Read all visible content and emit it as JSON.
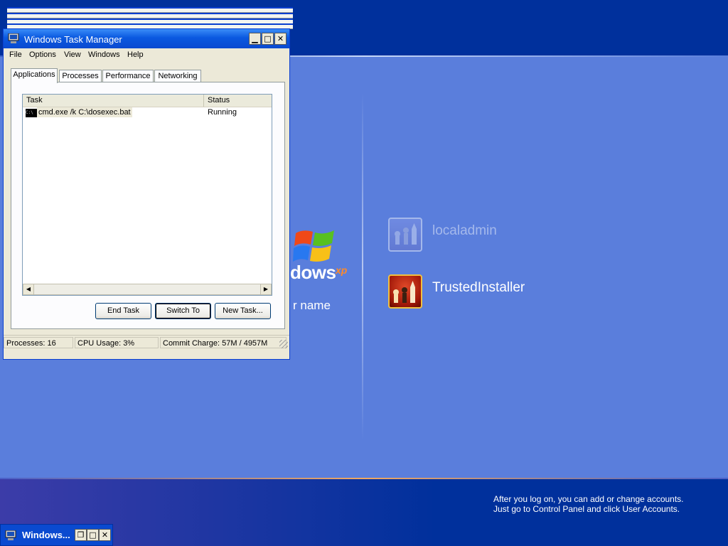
{
  "welcome": {
    "logo_text": "dows",
    "logo_xp": "xp",
    "logo_subtext": "r name",
    "help_line_1": "After you log on, you can add or change accounts.",
    "help_line_2": "Just go to Control Panel and click User Accounts.",
    "users": [
      {
        "name": "localadmin",
        "icon": "chess-pieces-icon"
      },
      {
        "name": "TrustedInstaller",
        "icon": "chess-pieces-icon"
      }
    ]
  },
  "task_manager": {
    "title": "Windows Task Manager",
    "menu": [
      "File",
      "Options",
      "View",
      "Windows",
      "Help"
    ],
    "tabs": [
      "Applications",
      "Processes",
      "Performance",
      "Networking"
    ],
    "active_tab": "Applications",
    "columns": [
      "Task",
      "Status"
    ],
    "rows": [
      {
        "task": "cmd.exe /k C:\\dosexec.bat",
        "status": "Running",
        "icon": "console-icon"
      }
    ],
    "buttons": {
      "end_task": "End Task",
      "switch_to": "Switch To",
      "new_task": "New Task..."
    },
    "status": {
      "processes": "Processes: 16",
      "cpu": "CPU Usage: 3%",
      "commit": "Commit Charge: 57M / 4957M"
    }
  },
  "minimized_window": {
    "title": "Windows..."
  },
  "colors": {
    "titlebar": "#0a4ad0",
    "desktop_blue": "#5a7edc",
    "dark_band": "#00309c"
  }
}
